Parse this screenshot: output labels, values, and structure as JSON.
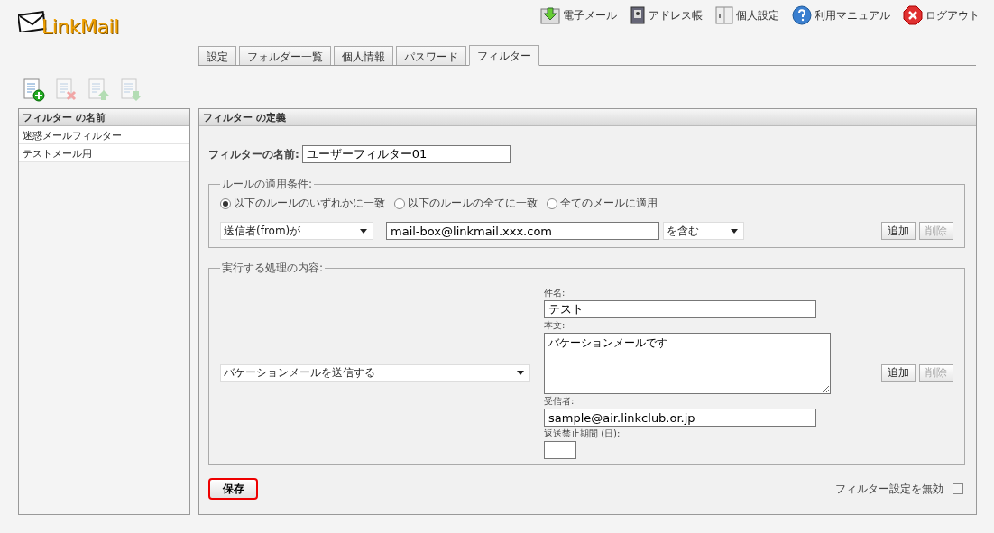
{
  "logo": {
    "text": "LinkMail"
  },
  "nav": [
    {
      "kind": "mail",
      "label": "電子メール"
    },
    {
      "kind": "contacts",
      "label": "アドレス帳"
    },
    {
      "kind": "settings",
      "label": "個人設定"
    },
    {
      "kind": "help",
      "label": "利用マニュアル"
    },
    {
      "kind": "logout",
      "label": "ログアウト"
    }
  ],
  "tabs": [
    {
      "label": "設定",
      "selected": false
    },
    {
      "label": "フォルダー一覧",
      "selected": false
    },
    {
      "label": "個人情報",
      "selected": false
    },
    {
      "label": "パスワード",
      "selected": false
    },
    {
      "label": "フィルター",
      "selected": true
    }
  ],
  "toolbar": [
    {
      "kind": "add",
      "disabled": false
    },
    {
      "kind": "delete",
      "disabled": true
    },
    {
      "kind": "up",
      "disabled": true
    },
    {
      "kind": "down",
      "disabled": true
    }
  ],
  "filter_list": {
    "header": "フィルター の名前",
    "items": [
      {
        "label": "迷惑メールフィルター"
      },
      {
        "label": "テストメール用"
      }
    ]
  },
  "definition": {
    "header": "フィルター の定義",
    "name_label": "フィルターの名前:",
    "name_value": "ユーザーフィルター01",
    "conditions": {
      "legend": "ルールの適用条件:",
      "options": [
        {
          "label": "以下のルールのいずれかに一致",
          "selected": true
        },
        {
          "label": "以下のルールの全てに一致",
          "selected": false
        },
        {
          "label": "全てのメールに適用",
          "selected": false
        }
      ],
      "field": "送信者(from)が",
      "value": "mail-box@linkmail.xxx.com",
      "operator": "を含む",
      "buttons": [
        {
          "label": "追加",
          "disabled": false
        },
        {
          "label": "削除",
          "disabled": true
        }
      ]
    },
    "actions": {
      "legend": "実行する処理の内容:",
      "action": "バケーションメールを送信する",
      "subject_label": "件名:",
      "subject_value": "テスト",
      "body_label": "本文:",
      "body_value": "バケーションメールです",
      "recipient_label": "受信者:",
      "recipient_value": "sample@air.linkclub.or.jp",
      "period_label": "返送禁止期間 (日):",
      "buttons": [
        {
          "label": "追加",
          "disabled": false
        },
        {
          "label": "削除",
          "disabled": true
        }
      ]
    },
    "save": "保存",
    "disable_label": "フィルター設定を無効",
    "disable_checked": false
  }
}
